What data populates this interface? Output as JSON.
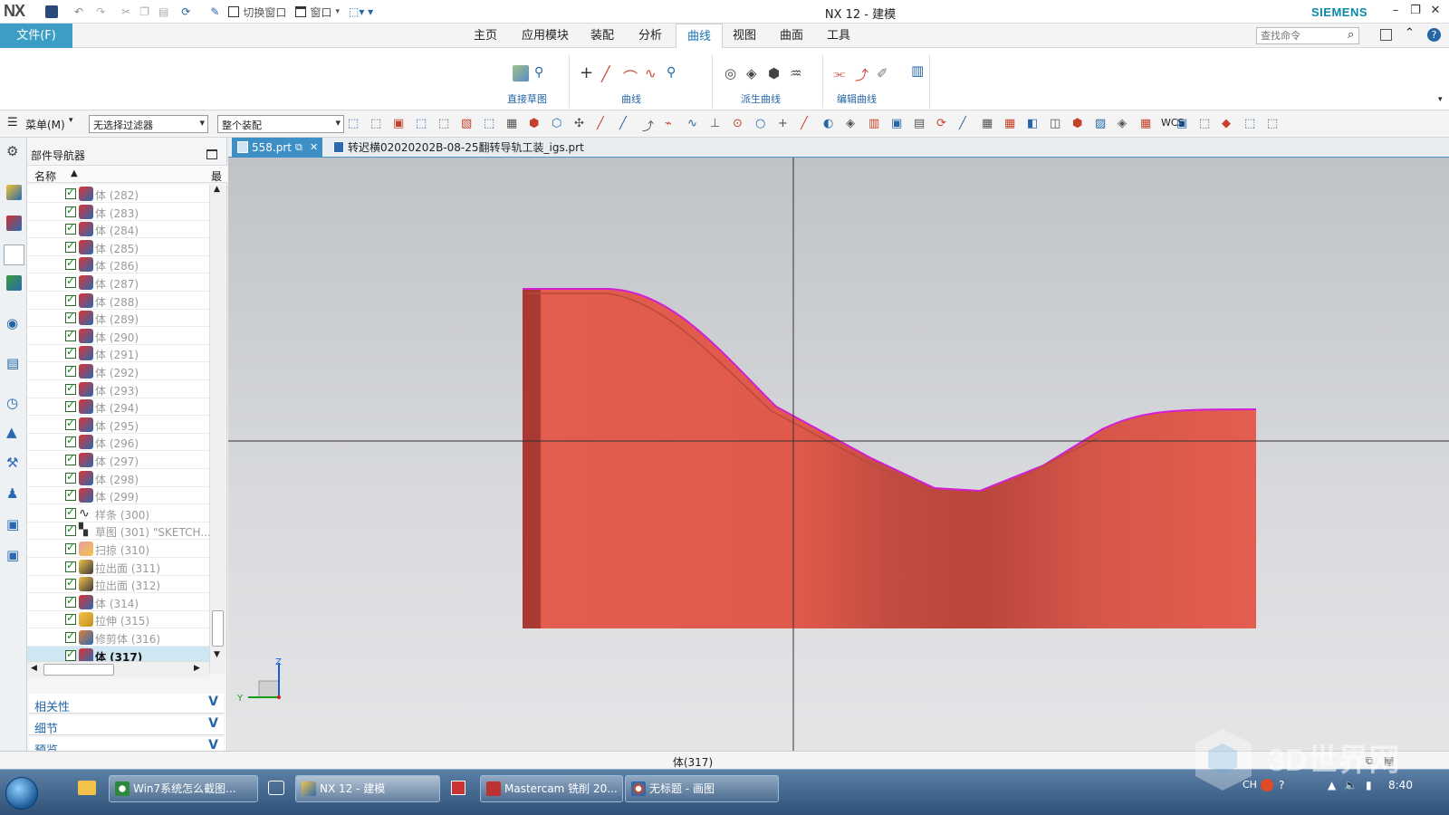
{
  "app": {
    "logo": "NX",
    "window_title": "NX 12 - 建模",
    "brand": "SIEMENS",
    "quick_access": {
      "switch_window": "切换窗口",
      "window": "窗口"
    }
  },
  "ribbon": {
    "file_button": "文件(F)",
    "tabs": [
      "主页",
      "应用模块",
      "装配",
      "分析",
      "曲线",
      "视图",
      "曲面",
      "工具"
    ],
    "active_tab": "曲线",
    "search_placeholder": "查找命令",
    "groups": [
      "直接草图",
      "曲线",
      "派生曲线",
      "编辑曲线"
    ]
  },
  "toolbar2": {
    "menu": "菜单(M)",
    "selection_filter": "无选择过滤器",
    "assembly_scope": "整个装配",
    "wcs": "WCS"
  },
  "navigator": {
    "title": "部件导航器",
    "column_name": "名称",
    "column_extra": "最",
    "items": [
      {
        "label": "体 (282)",
        "type": "body"
      },
      {
        "label": "体 (283)",
        "type": "body"
      },
      {
        "label": "体 (284)",
        "type": "body"
      },
      {
        "label": "体 (285)",
        "type": "body"
      },
      {
        "label": "体 (286)",
        "type": "body"
      },
      {
        "label": "体 (287)",
        "type": "body"
      },
      {
        "label": "体 (288)",
        "type": "body"
      },
      {
        "label": "体 (289)",
        "type": "body"
      },
      {
        "label": "体 (290)",
        "type": "body"
      },
      {
        "label": "体 (291)",
        "type": "body"
      },
      {
        "label": "体 (292)",
        "type": "body"
      },
      {
        "label": "体 (293)",
        "type": "body"
      },
      {
        "label": "体 (294)",
        "type": "body"
      },
      {
        "label": "体 (295)",
        "type": "body"
      },
      {
        "label": "体 (296)",
        "type": "body"
      },
      {
        "label": "体 (297)",
        "type": "body"
      },
      {
        "label": "体 (298)",
        "type": "body"
      },
      {
        "label": "体 (299)",
        "type": "body"
      },
      {
        "label": "样条 (300)",
        "type": "spline"
      },
      {
        "label": "草图 (301) \"SKETCH...",
        "type": "sketch"
      },
      {
        "label": "扫掠 (310)",
        "type": "sweep"
      },
      {
        "label": "拉出面 (311)",
        "type": "pull"
      },
      {
        "label": "拉出面 (312)",
        "type": "pull"
      },
      {
        "label": "体 (314)",
        "type": "body"
      },
      {
        "label": "拉伸 (315)",
        "type": "extrude"
      },
      {
        "label": "修剪体 (316)",
        "type": "trim"
      },
      {
        "label": "体 (317)",
        "type": "body",
        "selected": true
      }
    ],
    "panels": [
      "相关性",
      "细节",
      "预览"
    ]
  },
  "documents": {
    "tabs": [
      "558.prt",
      "转迟横02020202B-08-25翻转导轨工装_igs.prt"
    ],
    "active": "558.prt"
  },
  "viewport": {
    "triad": {
      "z": "Z",
      "y": "Y"
    },
    "colors": {
      "solid": "#e35e4f",
      "solid_dark": "#b8453a",
      "edge_highlight": "#d21fd6",
      "background": "#c9cbce"
    }
  },
  "status": {
    "selection": "体(317)"
  },
  "taskbar": {
    "tasks": [
      "Win7系统怎么截图...",
      "NX 12 - 建模",
      "Mastercam 铣削 20...",
      "无标题 - 画图"
    ],
    "tray_lang": "CH",
    "clock": "8:40"
  },
  "watermark": "3D世界网"
}
